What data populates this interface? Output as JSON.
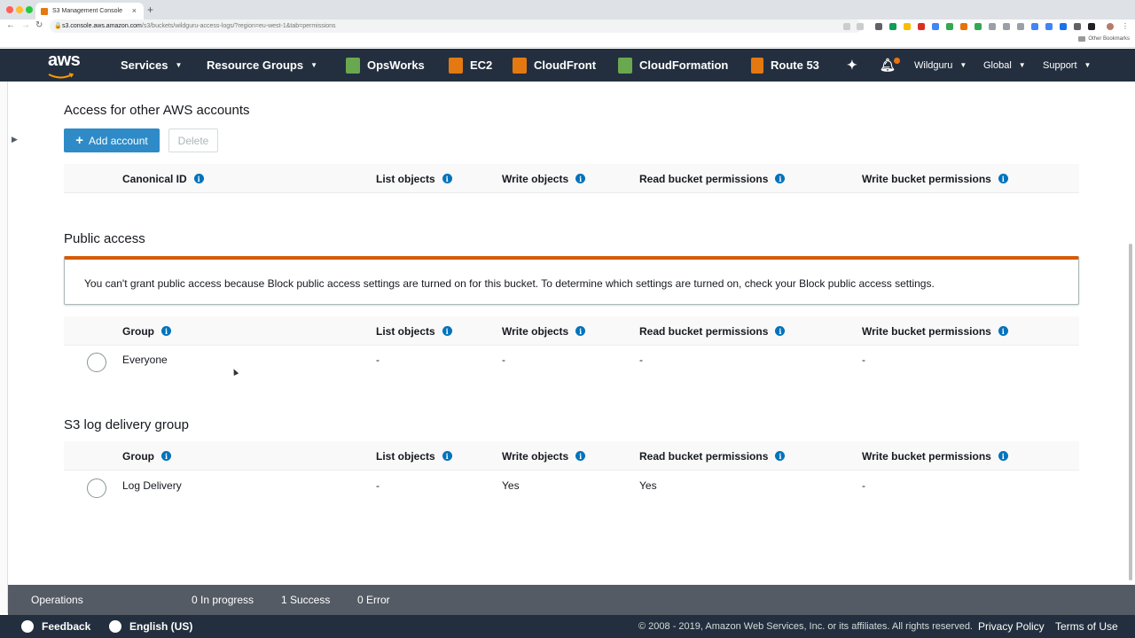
{
  "browser": {
    "tab_title": "S3 Management Console",
    "tab_close": "×",
    "new_tab": "+",
    "url_host": "s3.console.aws.amazon.com",
    "url_path": "/s3/buckets/wildguru-access-logs/?region=eu-west-1&tab=permissions",
    "bookmarks_other": "Other Bookmarks"
  },
  "aws_nav": {
    "logo": "aws",
    "services": "Services",
    "resource_groups": "Resource Groups",
    "shortcuts": [
      {
        "label": "OpsWorks",
        "color": "#6aa84f"
      },
      {
        "label": "EC2",
        "color": "#e47911"
      },
      {
        "label": "CloudFront",
        "color": "#e47911"
      },
      {
        "label": "CloudFormation",
        "color": "#6aa84f"
      },
      {
        "label": "Route 53",
        "color": "#e47911"
      }
    ],
    "account": "Wildguru",
    "region": "Global",
    "support": "Support"
  },
  "other_accounts": {
    "title": "Access for other AWS accounts",
    "add_button": "Add account",
    "delete_button": "Delete",
    "columns": [
      "Canonical ID",
      "List objects",
      "Write objects",
      "Read bucket permissions",
      "Write bucket permissions"
    ]
  },
  "public_access": {
    "title": "Public access",
    "alert": "You can't grant public access because Block public access settings are turned on for this bucket. To determine which settings are turned on, check your Block public access settings.",
    "columns": [
      "Group",
      "List objects",
      "Write objects",
      "Read bucket permissions",
      "Write bucket permissions"
    ],
    "rows": [
      {
        "name": "Everyone",
        "list": "-",
        "write": "-",
        "read_perm": "-",
        "write_perm": "-"
      }
    ]
  },
  "log_delivery": {
    "title": "S3 log delivery group",
    "columns": [
      "Group",
      "List objects",
      "Write objects",
      "Read bucket permissions",
      "Write bucket permissions"
    ],
    "rows": [
      {
        "name": "Log Delivery",
        "list": "-",
        "write": "Yes",
        "read_perm": "Yes",
        "write_perm": "-"
      }
    ]
  },
  "operations": {
    "label": "Operations",
    "in_progress": "0 In progress",
    "success": "1 Success",
    "error": "0 Error"
  },
  "footer": {
    "feedback": "Feedback",
    "language": "English (US)",
    "copyright": "© 2008 - 2019, Amazon Web Services, Inc. or its affiliates. All rights reserved.",
    "privacy": "Privacy Policy",
    "terms": "Terms of Use"
  },
  "colors": {
    "nav_bg": "#232f3e",
    "primary_button": "#2e8bc7",
    "alert_accent": "#d45b07",
    "info_icon": "#0073bb"
  }
}
